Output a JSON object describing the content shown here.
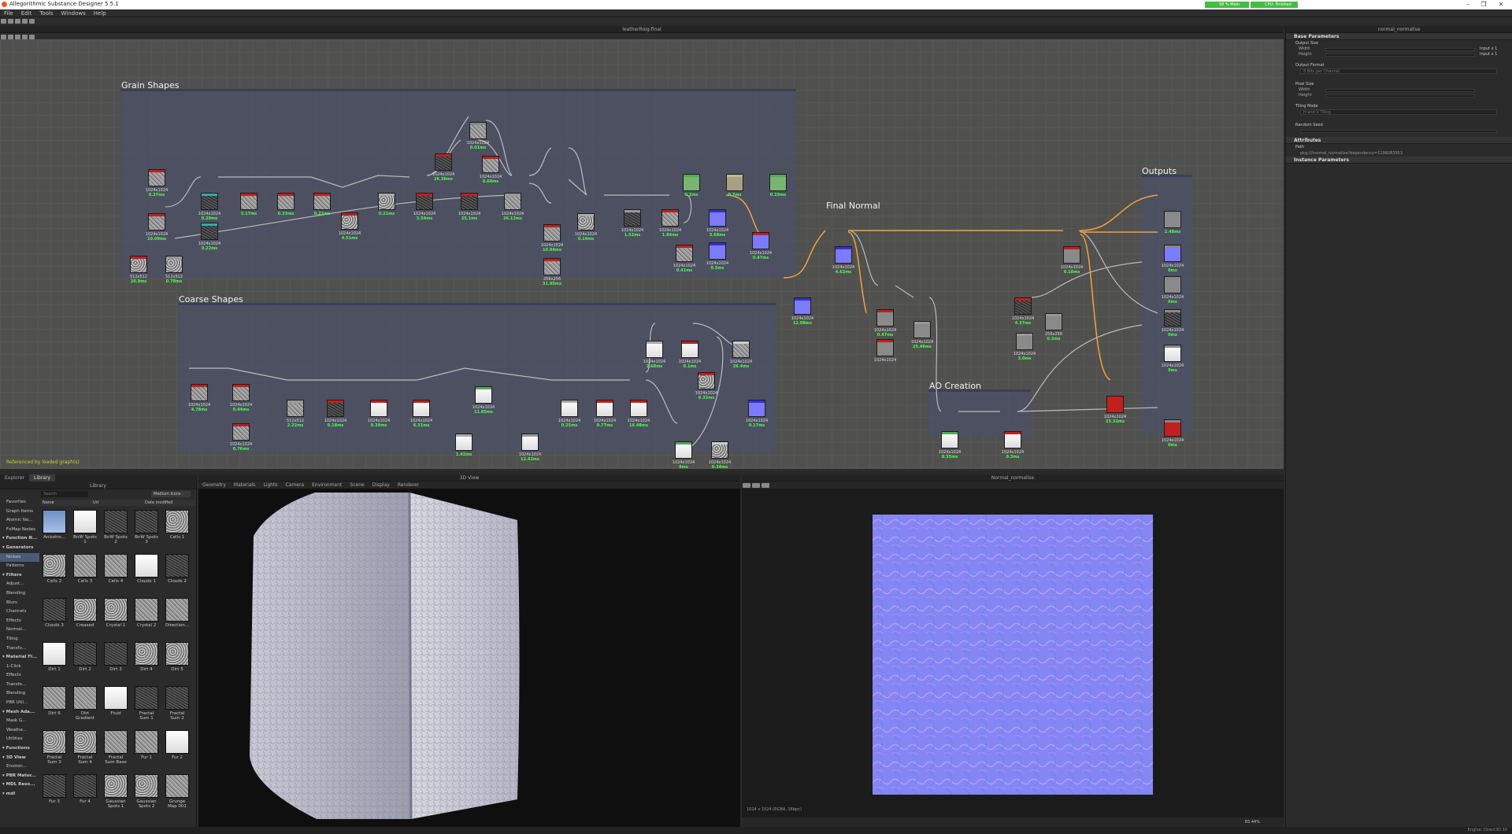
{
  "app": {
    "title": "Allegorithmic Substance Designer 5.5.1",
    "meter1": "58 %  Main",
    "meter2": "CPU: Finished"
  },
  "menu": [
    "File",
    "Edit",
    "Tools",
    "Windows",
    "Help"
  ],
  "graph": {
    "title": "leatherRoig-final",
    "status": "Referenced by loaded graph(s)",
    "frames": {
      "grain": "Grain Shapes",
      "coarse": "Coarse Shapes",
      "final": "Final Normal",
      "ao": "AO Creation",
      "outputs": "Outputs"
    },
    "nodes": [
      {
        "res": "1024x1024",
        "time": "8.37ms"
      },
      {
        "res": "1024x1024",
        "time": "10.09ms"
      },
      {
        "res": "512x512",
        "time": "20.9ms"
      },
      {
        "res": "512x512",
        "time": "0.78ms"
      },
      {
        "res": "1024x1024",
        "time": "0.20ms"
      },
      {
        "res": "1024x1024",
        "time": "0.22ms"
      },
      {
        "res": "",
        "time": "5.17ms"
      },
      {
        "res": "",
        "time": "0.33ms"
      },
      {
        "res": "",
        "time": "0.22ms"
      },
      {
        "res": "1024x1024",
        "time": "4.51ms"
      },
      {
        "res": "",
        "time": "0.21ms"
      },
      {
        "res": "1024x1024",
        "time": "3.54ms"
      },
      {
        "res": "1024x1024",
        "time": "26.38ms"
      },
      {
        "res": "1024x1024",
        "time": "25.1ms"
      },
      {
        "res": "1024x1024",
        "time": "0.01ms"
      },
      {
        "res": "1024x1024",
        "time": "0.60ms"
      },
      {
        "res": "1024x1024",
        "time": "26.12ms"
      },
      {
        "res": "1024x1024",
        "time": "10.94ms"
      },
      {
        "res": "256x256",
        "time": "31.05ms"
      },
      {
        "res": "1024x1024",
        "time": "0.14ms"
      },
      {
        "res": "1024x1024",
        "time": "1.52ms"
      },
      {
        "res": "1024x1024",
        "time": "1.84ms"
      },
      {
        "res": "1024x1024",
        "time": "0.41ms"
      },
      {
        "res": "1024x1024",
        "time": "3.68ms"
      },
      {
        "res": "",
        "time": "0.2ms"
      },
      {
        "res": "",
        "time": "0.7ms"
      },
      {
        "res": "",
        "time": "0.19ms"
      },
      {
        "res": "1024x1024",
        "time": "0.5ms"
      },
      {
        "res": "1024x1024",
        "time": "0.47ms"
      },
      {
        "res": "1024x1024",
        "time": "12.08ms"
      },
      {
        "res": "1024x1024",
        "time": "4.62ms"
      },
      {
        "res": "1024x1024",
        "time": "4.78ms"
      },
      {
        "res": "1024x1024",
        "time": "8.44ms"
      },
      {
        "res": "1024x1024",
        "time": "0.76ms"
      },
      {
        "res": "512x512",
        "time": "2.22ms"
      },
      {
        "res": "1024x1024",
        "time": "0.18ms"
      },
      {
        "res": "1024x1024",
        "time": "8.39ms"
      },
      {
        "res": "1024x1024",
        "time": "6.31ms"
      },
      {
        "res": "1024x1024",
        "time": "11.85ms"
      },
      {
        "res": "",
        "time": "1.42ms"
      },
      {
        "res": "1024x1024",
        "time": "12.42ms"
      },
      {
        "res": "1024x1024",
        "time": "0.25ms"
      },
      {
        "res": "1024x1024",
        "time": "0.77ms"
      },
      {
        "res": "1024x1024",
        "time": "16.48ms"
      },
      {
        "res": "1024x1024",
        "time": "2.68ms"
      },
      {
        "res": "1024x1024",
        "time": "0.1ms"
      },
      {
        "res": "1024x1024",
        "time": "9.33ms"
      },
      {
        "res": "1024x1024",
        "time": "26.4ms"
      },
      {
        "res": "1024x1024",
        "time": "9ms"
      },
      {
        "res": "1024x1024",
        "time": "0.34ms"
      },
      {
        "res": "1024x1024",
        "time": "0.17ms"
      },
      {
        "res": "1024x1024",
        "time": "0.47ms"
      },
      {
        "res": "1024x1024",
        "time": ""
      },
      {
        "res": "1024x1024",
        "time": "25.46ms"
      },
      {
        "res": "1024x1024",
        "time": "0.35ms"
      },
      {
        "res": "1024x1024",
        "time": "0.3ms"
      },
      {
        "res": "1024x1024",
        "time": "4.37ms"
      },
      {
        "res": "1024x1024",
        "time": "3.0ms"
      },
      {
        "res": "256x256",
        "time": "0.2ms"
      },
      {
        "res": "1024x1024",
        "time": "0.18ms"
      },
      {
        "res": "1024x1024",
        "time": "23.32ms"
      },
      {
        "res": "",
        "time": "2.48ms"
      },
      {
        "res": "1024x1024",
        "time": "8ms"
      },
      {
        "res": "1024x1024",
        "time": "0ms"
      },
      {
        "res": "1024x1024",
        "time": "0ms"
      },
      {
        "res": "1024x1024",
        "time": "0ms"
      },
      {
        "res": "1024x1024",
        "time": "0ms"
      },
      {
        "res": "",
        "time": "0.47ms"
      }
    ]
  },
  "params": {
    "title": "normal_normalise",
    "base": "Base Parameters",
    "output_size": "Output Size",
    "width": "Width",
    "height": "Height",
    "width_val": "0",
    "height_val": "0",
    "width_rel": "Input x 1",
    "height_rel": "Input x 1",
    "output_format": "Output Format",
    "output_format_val": "8 Bits per Channel",
    "pixel_size": "Pixel Size",
    "ps_w": "1",
    "ps_h": "1",
    "tiling": "Tiling Mode",
    "tiling_val": "H and V Tiling",
    "seed": "Random Seed",
    "seed_val": "0",
    "attributes": "Attributes",
    "path": "Path",
    "path_val": "pkg:///normal_normalise?dependency=1198283953",
    "instance": "Instance Parameters"
  },
  "library": {
    "tabs": [
      "Explorer",
      "Library"
    ],
    "panel_title": "Library",
    "search": "Search",
    "view": "Medium Icons",
    "cols": [
      "Name",
      "Url",
      "Date modified"
    ],
    "tree": [
      {
        "t": "Favorites",
        "h": false
      },
      {
        "t": "Graph Items",
        "h": false
      },
      {
        "t": "Atomic No...",
        "h": false
      },
      {
        "t": "FxMap Nodes",
        "h": false
      },
      {
        "t": "Function N...",
        "h": true
      },
      {
        "t": "Generators",
        "h": true
      },
      {
        "t": "Noises",
        "h": false,
        "sel": true
      },
      {
        "t": "Patterns",
        "h": false
      },
      {
        "t": "Filters",
        "h": true
      },
      {
        "t": "Adjust...",
        "h": false
      },
      {
        "t": "Blending",
        "h": false
      },
      {
        "t": "Blurs",
        "h": false
      },
      {
        "t": "Channels",
        "h": false
      },
      {
        "t": "Effects",
        "h": false
      },
      {
        "t": "Normal...",
        "h": false
      },
      {
        "t": "Tiling",
        "h": false
      },
      {
        "t": "Transfo...",
        "h": false
      },
      {
        "t": "Material Fi...",
        "h": true
      },
      {
        "t": "1-Click",
        "h": false
      },
      {
        "t": "Effects",
        "h": false
      },
      {
        "t": "Transfo...",
        "h": false
      },
      {
        "t": "Blending",
        "h": false
      },
      {
        "t": "PBR Util...",
        "h": false
      },
      {
        "t": "Mesh Ada...",
        "h": true
      },
      {
        "t": "Mask G...",
        "h": false
      },
      {
        "t": "Weathe...",
        "h": false
      },
      {
        "t": "Utilities",
        "h": false
      },
      {
        "t": "Functions",
        "h": true
      },
      {
        "t": "3D View",
        "h": true
      },
      {
        "t": "Environ...",
        "h": false
      },
      {
        "t": "PBR Mater...",
        "h": true
      },
      {
        "t": "MDL Reso...",
        "h": true
      },
      {
        "t": "mdl",
        "h": true
      }
    ],
    "items": [
      "Anisotro...",
      "BnW Spots 1",
      "BnW Spots 2",
      "BnW Spots 3",
      "Cells 1",
      "Cells 2",
      "Cells 3",
      "Cells 4",
      "Clouds 1",
      "Clouds 2",
      "Clouds 3",
      "Creased",
      "Crystal 1",
      "Crystal 2",
      "Direction...",
      "Dirt 1",
      "Dirt 2",
      "Dirt 3",
      "Dirt 4",
      "Dirt 5",
      "Dirt 6",
      "Dirt Gradient",
      "Fluid",
      "Fractal Sum 1",
      "Fractal Sum 2",
      "Fractal Sum 3",
      "Fractal Sum 4",
      "Fractal Sum Base",
      "Fur 1",
      "Fur 2",
      "Fur 3",
      "Fur 4",
      "Gaussian Spots 1",
      "Gaussian Spots 2",
      "Grunge Map 001"
    ]
  },
  "view3d": {
    "title": "3D View",
    "menu": [
      "Geometry",
      "Materials",
      "Lights",
      "Camera",
      "Environment",
      "Scene",
      "Display",
      "Renderer"
    ]
  },
  "view2d": {
    "title": "Normal_normalise",
    "info": "1024 x 1024 (RGBA, 16bpc)",
    "zoom": "65.44%"
  },
  "status": {
    "engine": "Engine: Direct3D 10"
  },
  "colors": {
    "accent_orange": "#f2a33a",
    "normal_blue": "#8080ff",
    "time_green": "#4cff4c"
  }
}
